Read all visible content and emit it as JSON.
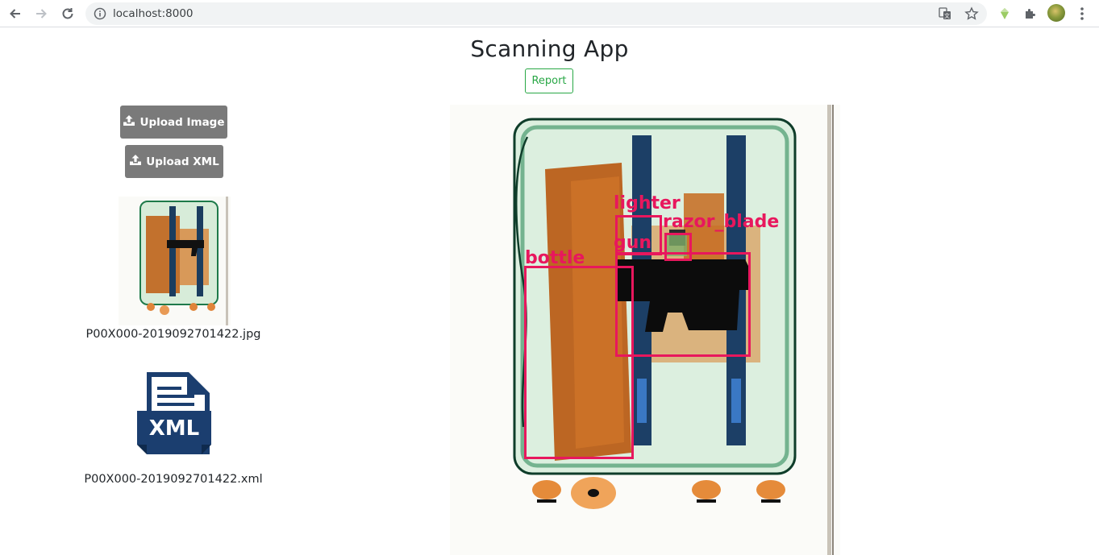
{
  "browser": {
    "url": "localhost:8000"
  },
  "header": {
    "title": "Scanning App",
    "report_label": "Report"
  },
  "sidebar": {
    "upload_image_label": "Upload Image",
    "upload_xml_label": "Upload XML",
    "image_filename": "P00X000-2019092701422.jpg",
    "xml_icon_text": "XML",
    "xml_filename": "P00X000-2019092701422.xml"
  },
  "detections": {
    "color": "#e8175d",
    "labels": {
      "lighter": "lighter",
      "razor_blade": "razor_blade",
      "gun": "gun",
      "bottle": "bottle"
    }
  },
  "colors": {
    "report_accent": "#28a745",
    "upload_button": "#7a7a7a",
    "xml_icon_blue": "#1b3e6f"
  }
}
